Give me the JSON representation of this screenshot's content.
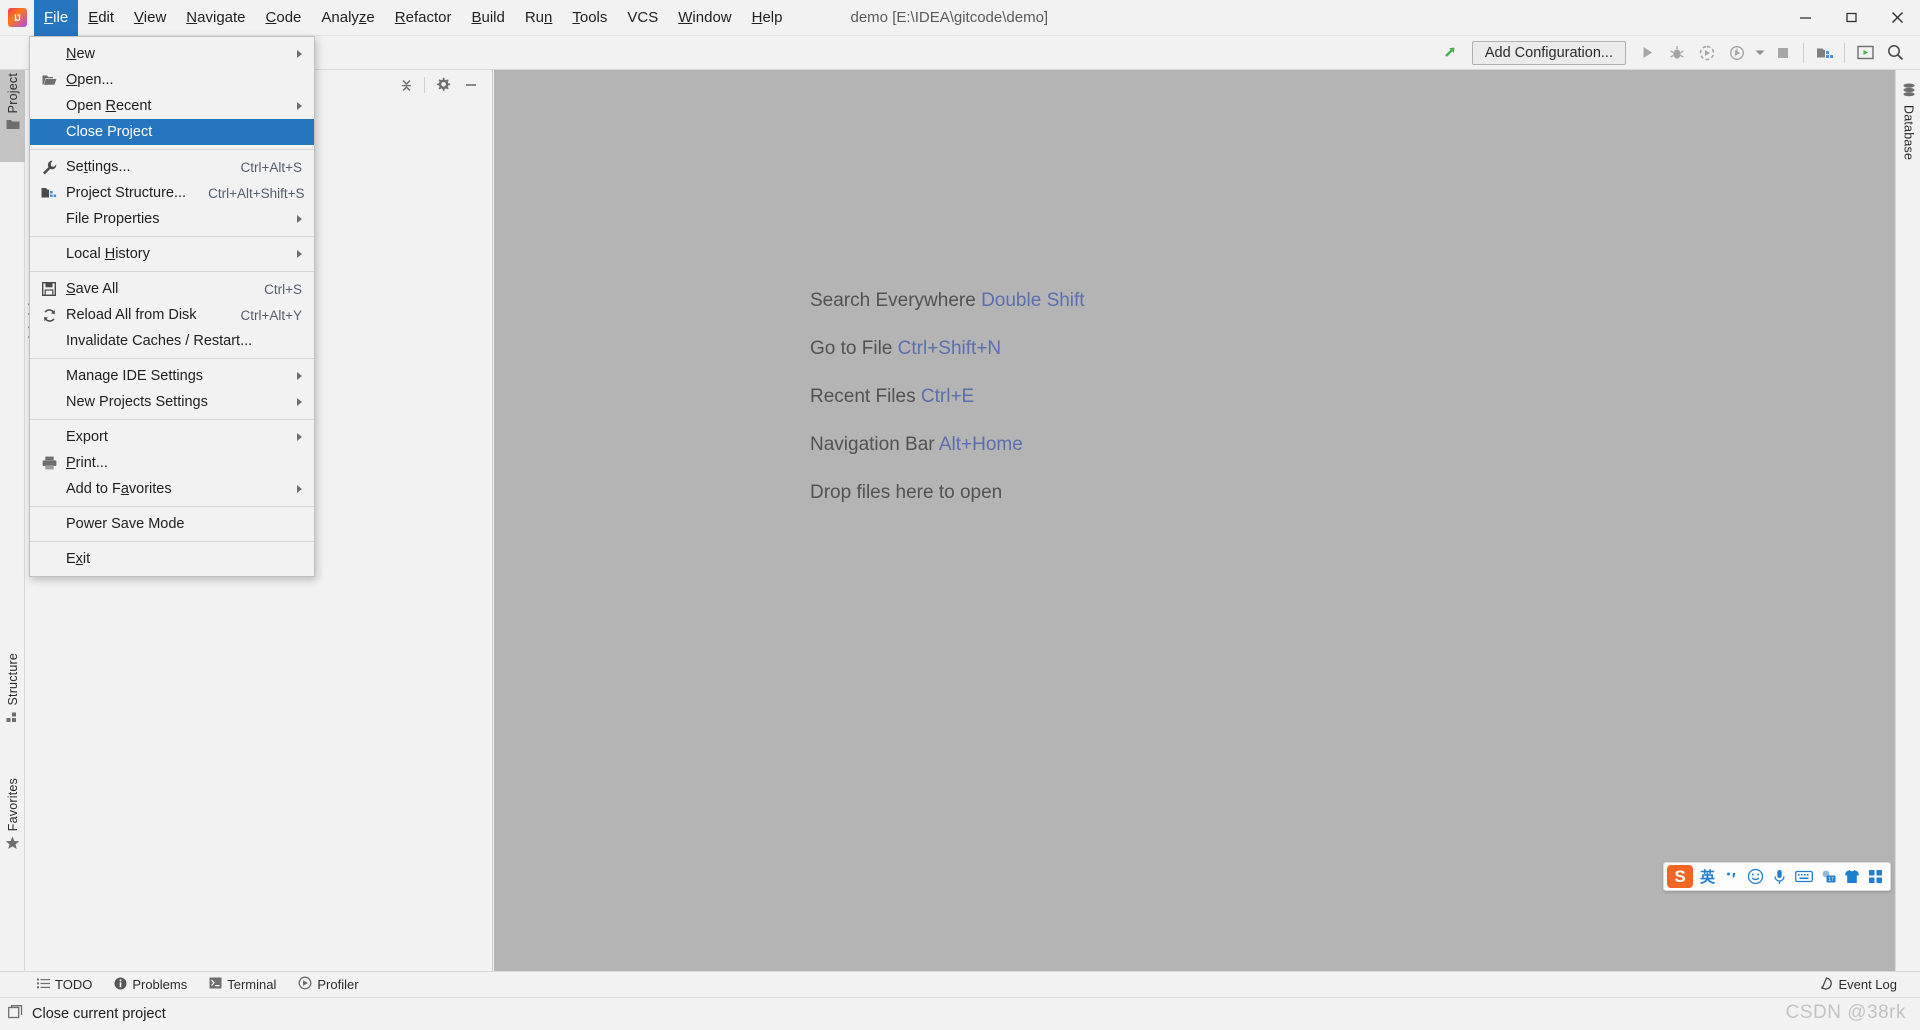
{
  "window": {
    "app_icon": "intellij-idea-logo",
    "title": "demo [E:\\IDEA\\gitcode\\demo]",
    "minimize_label": "Minimize",
    "maximize_label": "Maximize",
    "close_label": "Close"
  },
  "menubar": [
    {
      "label": "File",
      "mnemonic": "F",
      "active": true
    },
    {
      "label": "Edit",
      "mnemonic": "E",
      "active": false
    },
    {
      "label": "View",
      "mnemonic": "V",
      "active": false
    },
    {
      "label": "Navigate",
      "mnemonic": "N",
      "active": false
    },
    {
      "label": "Code",
      "mnemonic": "C",
      "active": false
    },
    {
      "label": "Analyze",
      "mnemonic": "z",
      "active": false
    },
    {
      "label": "Refactor",
      "mnemonic": "R",
      "active": false
    },
    {
      "label": "Build",
      "mnemonic": "B",
      "active": false
    },
    {
      "label": "Run",
      "mnemonic": "n",
      "active": false
    },
    {
      "label": "Tools",
      "mnemonic": "T",
      "active": false
    },
    {
      "label": "VCS",
      "mnemonic": "",
      "active": false
    },
    {
      "label": "Window",
      "mnemonic": "W",
      "active": false
    },
    {
      "label": "Help",
      "mnemonic": "H",
      "active": false
    }
  ],
  "file_menu": {
    "highlighted_item": "Close Project",
    "items": [
      {
        "label": "New",
        "mnemonic": "N",
        "shortcut": "",
        "submenu": true,
        "icon": "",
        "selected": false
      },
      {
        "label": "Open...",
        "mnemonic": "O",
        "shortcut": "",
        "submenu": false,
        "icon": "folder-open-icon",
        "selected": false
      },
      {
        "label": "Open Recent",
        "mnemonic": "R",
        "shortcut": "",
        "submenu": true,
        "icon": "",
        "selected": false
      },
      {
        "label": "Close Project",
        "mnemonic": "",
        "shortcut": "",
        "submenu": false,
        "icon": "",
        "selected": true
      },
      {
        "separator_after": false,
        "label": "Settings...",
        "mnemonic": "t",
        "shortcut": "Ctrl+Alt+S",
        "submenu": false,
        "icon": "wrench-icon",
        "selected": false
      },
      {
        "label": "Project Structure...",
        "mnemonic": "",
        "shortcut": "Ctrl+Alt+Shift+S",
        "submenu": false,
        "icon": "project-structure-icon",
        "selected": false
      },
      {
        "label": "File Properties",
        "mnemonic": "",
        "shortcut": "",
        "submenu": true,
        "icon": "",
        "selected": false
      },
      {
        "label": "Local History",
        "mnemonic": "H",
        "shortcut": "",
        "submenu": true,
        "icon": "",
        "selected": false
      },
      {
        "label": "Save All",
        "mnemonic": "S",
        "shortcut": "Ctrl+S",
        "submenu": false,
        "icon": "save-icon",
        "selected": false
      },
      {
        "label": "Reload All from Disk",
        "mnemonic": "",
        "shortcut": "Ctrl+Alt+Y",
        "submenu": false,
        "icon": "refresh-icon",
        "selected": false
      },
      {
        "label": "Invalidate Caches / Restart...",
        "mnemonic": "",
        "shortcut": "",
        "submenu": false,
        "icon": "",
        "selected": false
      },
      {
        "label": "Manage IDE Settings",
        "mnemonic": "",
        "shortcut": "",
        "submenu": true,
        "icon": "",
        "selected": false
      },
      {
        "label": "New Projects Settings",
        "mnemonic": "",
        "shortcut": "",
        "submenu": true,
        "icon": "",
        "selected": false
      },
      {
        "label": "Export",
        "mnemonic": "",
        "shortcut": "",
        "submenu": true,
        "icon": "",
        "selected": false
      },
      {
        "label": "Print...",
        "mnemonic": "P",
        "shortcut": "",
        "submenu": false,
        "icon": "printer-icon",
        "selected": false
      },
      {
        "label": "Add to Favorites",
        "mnemonic": "a",
        "shortcut": "",
        "submenu": true,
        "icon": "",
        "selected": false
      },
      {
        "label": "Power Save Mode",
        "mnemonic": "",
        "shortcut": "",
        "submenu": false,
        "icon": "",
        "selected": false
      },
      {
        "label": "Exit",
        "mnemonic": "x",
        "shortcut": "",
        "submenu": false,
        "icon": "",
        "selected": false
      }
    ]
  },
  "toolbar": {
    "update_project_label": "Update Project",
    "add_configuration_label": "Add Configuration...",
    "run_label": "Run",
    "debug_label": "Debug",
    "run_with_coverage_label": "Run with Coverage",
    "profile_label": "Profile",
    "stop_label": "Stop",
    "project_structure_label": "Project Structure",
    "select_in_label": "Select In",
    "search_everywhere_label": "Search Everywhere"
  },
  "project_panel": {
    "collapse_all_label": "Collapse All",
    "settings_label": "Settings",
    "hide_label": "Hide"
  },
  "left_stripe": [
    {
      "label": "Project",
      "icon": "folder-icon",
      "selected": true
    },
    {
      "label": "Structure",
      "icon": "structure-icon",
      "selected": false
    },
    {
      "label": "Favorites",
      "icon": "star-icon",
      "selected": false
    }
  ],
  "right_stripe": [
    {
      "label": "Database",
      "icon": "database-icon",
      "selected": false
    }
  ],
  "editor_hints": [
    {
      "text": "Search Everywhere",
      "key": "Double Shift"
    },
    {
      "text": "Go to File",
      "key": "Ctrl+Shift+N"
    },
    {
      "text": "Recent Files",
      "key": "Ctrl+E"
    },
    {
      "text": "Navigation Bar",
      "key": "Alt+Home"
    },
    {
      "text": "Drop files here to open",
      "key": ""
    }
  ],
  "ime": {
    "logo": "sogou-logo",
    "mode_label": "英",
    "punctuation_icon": "punctuation-icon",
    "emoji_icon": "smiley-icon",
    "voice_icon": "microphone-icon",
    "keyboard_icon": "keyboard-icon",
    "calendar_icon": "calendar-icon",
    "skin_icon": "shirt-icon",
    "toolbox_icon": "grid-icon"
  },
  "toolwindow_bar": [
    {
      "label": "TODO",
      "icon": "todo-list-icon"
    },
    {
      "label": "Problems",
      "icon": "problems-icon"
    },
    {
      "label": "Terminal",
      "icon": "terminal-icon"
    },
    {
      "label": "Profiler",
      "icon": "profiler-icon"
    }
  ],
  "event_log": {
    "label": "Event Log",
    "icon": "event-log-icon"
  },
  "statusbar": {
    "message": "Close current project",
    "icon": "window-icon"
  },
  "watermark": "CSDN @38rk",
  "colors": {
    "accent_blue": "#2675bf",
    "editor_bg": "#b4b4b4",
    "chrome_bg": "#f2f2f2",
    "hint_key": "#5b6eae",
    "ime_orange": "#f26522"
  }
}
